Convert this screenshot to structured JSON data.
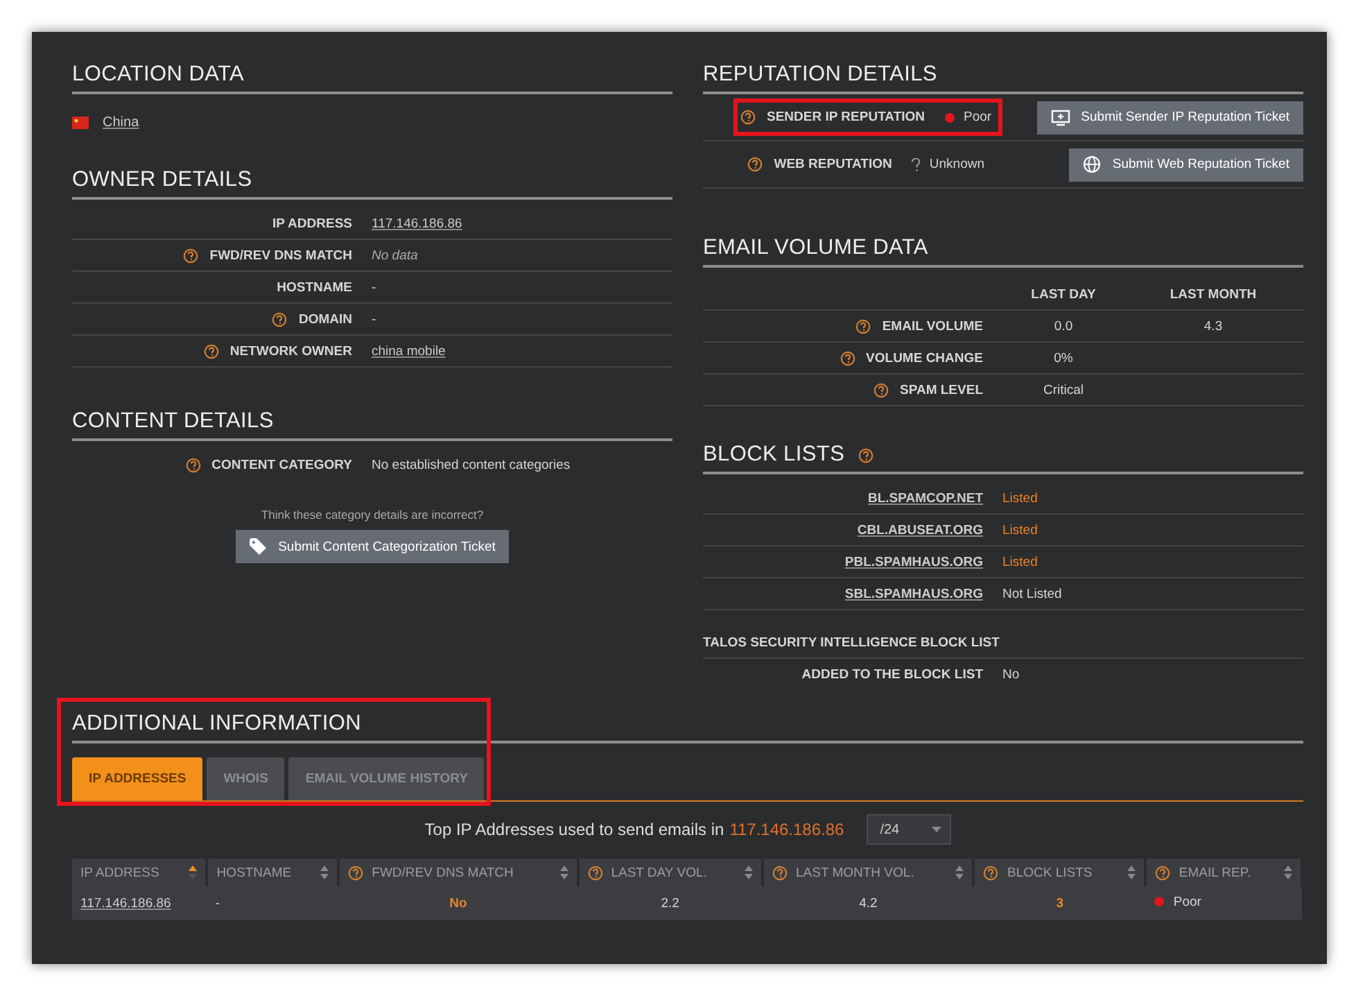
{
  "location": {
    "heading": "LOCATION DATA",
    "country": "China"
  },
  "owner": {
    "heading": "OWNER DETAILS",
    "rows": [
      {
        "label": "IP ADDRESS",
        "help": false,
        "value": "117.146.186.86",
        "kind": "link"
      },
      {
        "label": "FWD/REV DNS MATCH",
        "help": true,
        "value": "No data",
        "kind": "muted"
      },
      {
        "label": "HOSTNAME",
        "help": false,
        "value": "-",
        "kind": "text"
      },
      {
        "label": "DOMAIN",
        "help": true,
        "value": "-",
        "kind": "text"
      },
      {
        "label": "NETWORK OWNER",
        "help": true,
        "value": "china mobile",
        "kind": "link"
      }
    ]
  },
  "content": {
    "heading": "CONTENT DETAILS",
    "label": "CONTENT CATEGORY",
    "value": "No established content categories",
    "note": "Think these category details are incorrect?",
    "button": "Submit Content Categorization Ticket"
  },
  "reputation": {
    "heading": "REPUTATION DETAILS",
    "rows": [
      {
        "label": "SENDER IP REPUTATION",
        "kind": "poor",
        "value": "Poor",
        "button": {
          "label": "Submit Sender IP Reputation Ticket",
          "kind": "monitor"
        },
        "highlighted": true
      },
      {
        "label": "WEB REPUTATION",
        "kind": "unknown",
        "value": "Unknown",
        "button": {
          "label": "Submit Web Reputation Ticket",
          "kind": "globe"
        },
        "highlighted": false
      }
    ]
  },
  "email_volume": {
    "heading": "EMAIL VOLUME DATA",
    "columns": [
      "LAST DAY",
      "LAST MONTH"
    ],
    "rows": [
      {
        "label": "EMAIL VOLUME",
        "values": [
          "0.0",
          "4.3"
        ]
      },
      {
        "label": "VOLUME CHANGE",
        "values": [
          "0%"
        ]
      },
      {
        "label": "SPAM LEVEL",
        "values": [
          "Critical"
        ]
      }
    ]
  },
  "block_lists": {
    "heading": "BLOCK LISTS",
    "rows": [
      {
        "name": "BL.SPAMCOP.NET",
        "value": "Listed",
        "listed": true
      },
      {
        "name": "CBL.ABUSEAT.ORG",
        "value": "Listed",
        "listed": true
      },
      {
        "name": "PBL.SPAMHAUS.ORG",
        "value": "Listed",
        "listed": true
      },
      {
        "name": "SBL.SPAMHAUS.ORG",
        "value": "Not Listed",
        "listed": false
      }
    ],
    "talos_heading": "TALOS SECURITY INTELLIGENCE BLOCK LIST",
    "talos_label": "ADDED TO THE BLOCK LIST",
    "talos_value": "No"
  },
  "additional": {
    "heading": "ADDITIONAL INFORMATION",
    "highlighted": true,
    "tabs": [
      {
        "label": "IP ADDRESSES",
        "selected": true
      },
      {
        "label": "WHOIS",
        "selected": false
      },
      {
        "label": "EMAIL VOLUME HISTORY",
        "selected": false
      }
    ],
    "caption": "Top IP Addresses used to send emails in",
    "caption_ip": "117.146.186.86",
    "range": "/24",
    "table": {
      "columns": [
        {
          "label": "IP ADDRESS",
          "help": false,
          "sorted": true
        },
        {
          "label": "HOSTNAME",
          "help": false,
          "sorted": false
        },
        {
          "label": "FWD/REV DNS MATCH",
          "help": true,
          "sorted": false
        },
        {
          "label": "LAST DAY VOL.",
          "help": true,
          "sorted": false
        },
        {
          "label": "LAST MONTH VOL.",
          "help": true,
          "sorted": false
        },
        {
          "label": "BLOCK LISTS",
          "help": true,
          "sorted": false
        },
        {
          "label": "EMAIL REP.",
          "help": true,
          "sorted": false
        }
      ],
      "rows": [
        [
          {
            "kind": "link",
            "text": "117.146.186.86"
          },
          {
            "kind": "text",
            "text": "-"
          },
          {
            "kind": "alert",
            "text": "No"
          },
          {
            "kind": "number",
            "text": "2.2"
          },
          {
            "kind": "number",
            "text": "4.2"
          },
          {
            "kind": "alert",
            "text": "3"
          },
          {
            "kind": "poor",
            "text": "Poor"
          }
        ]
      ]
    }
  }
}
